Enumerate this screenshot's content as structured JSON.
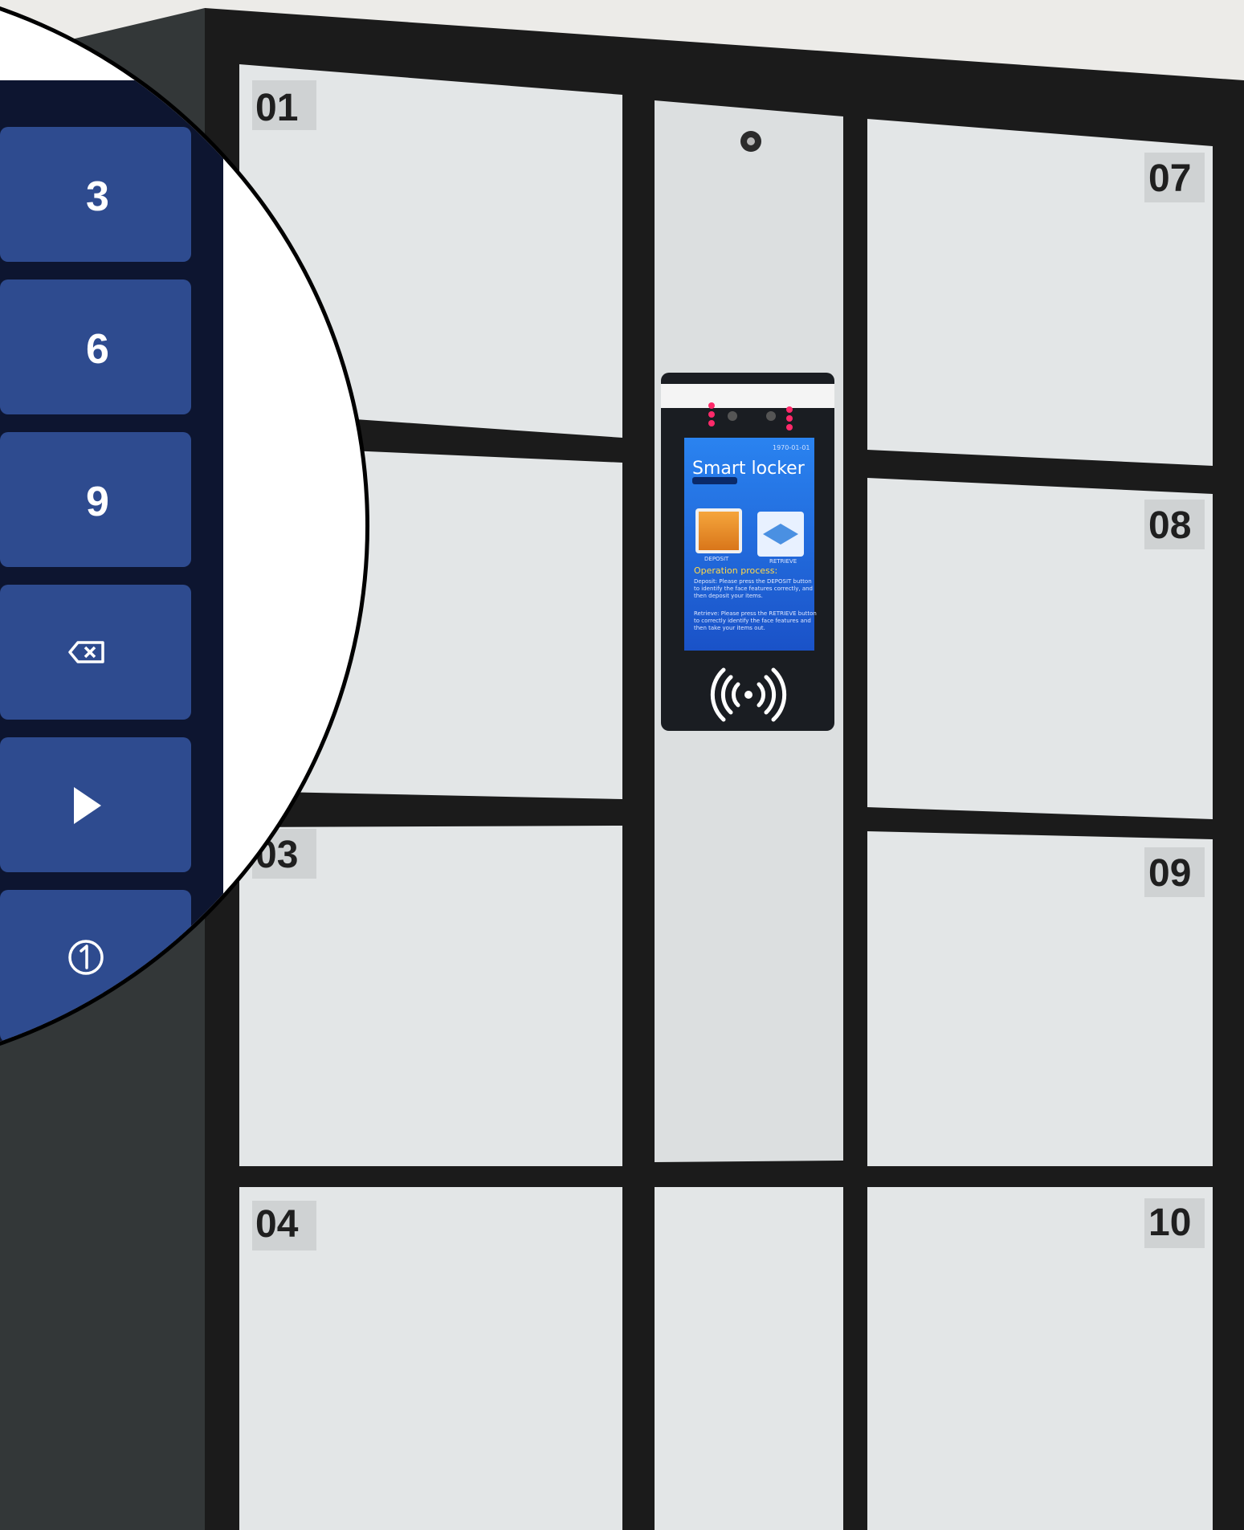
{
  "locker": {
    "left_boxes": [
      "01",
      "03",
      "04"
    ],
    "right_boxes": [
      "07",
      "08",
      "09",
      "10"
    ]
  },
  "screen": {
    "date": "1970-01-01",
    "title": "Smart locker",
    "deposit_label": "DEPOSIT",
    "retrieve_label": "RETRIEVE",
    "process_heading": "Operation process:",
    "deposit_text_1": "Deposit: Please press the DEPOSIT button",
    "deposit_text_2": "to identify the face features correctly, and",
    "deposit_text_3": "then deposit your items.",
    "retrieve_text_1": "Retrieve: Please press the RETRIEVE button",
    "retrieve_text_2": "to correctly identify the face features and",
    "retrieve_text_3": "then take your items out."
  },
  "keypad": {
    "keys": [
      "3",
      "6",
      "9"
    ]
  },
  "icons": {
    "backspace": "backspace-icon",
    "play": "play-icon",
    "info": "circled-one-icon",
    "nfc": "nfc-icon",
    "lock": "lock-icon"
  },
  "colors": {
    "key": "#2e4b8f",
    "keypad_bg": "#0d1530",
    "cabinet_frame": "#1a1a1a",
    "door": "#e6e9ea",
    "screen": "#1f6fe0"
  }
}
